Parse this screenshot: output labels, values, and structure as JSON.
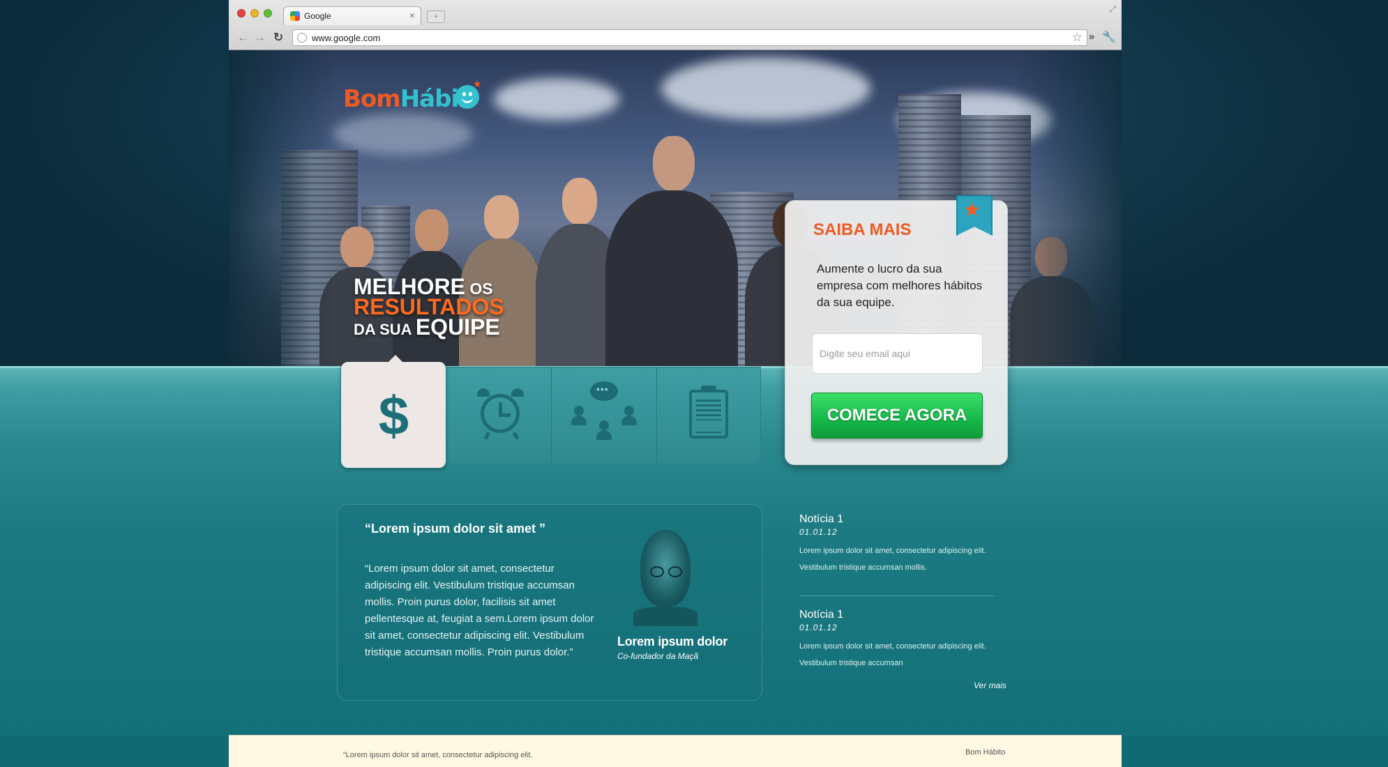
{
  "browser": {
    "tab_title": "Google",
    "tab_close": "×",
    "new_tab": "+",
    "url": "www.google.com",
    "icons": {
      "back": "arrow-left",
      "forward": "arrow-right",
      "reload": "reload",
      "bookmark": "star",
      "extensions": "chevrons",
      "settings": "wrench"
    }
  },
  "brand": {
    "name_part1": "Bom",
    "name_part2": "Hábit",
    "primary_color": "#ee5a24",
    "secondary_color": "#33c1d0"
  },
  "hero": {
    "line1_big": "MELHORE",
    "line1_small": " OS",
    "line2": "RESULTADOS",
    "line3_small": "DA SUA ",
    "line3_big": "EQUIPE"
  },
  "feature_tabs": [
    {
      "icon": "dollar-icon",
      "symbol": "$",
      "active": true
    },
    {
      "icon": "alarm-clock-icon",
      "active": false
    },
    {
      "icon": "team-chat-icon",
      "chat_dots": "•••",
      "active": false
    },
    {
      "icon": "clipboard-report-icon",
      "active": false
    }
  ],
  "signup": {
    "title": "SAIBA MAIS",
    "description": "Aumente o lucro da sua empresa com melhores hábitos da sua equipe.",
    "email_placeholder": "Digite seu email aqui",
    "email_value": "",
    "cta_label": "COMECE AGORA",
    "cta_color": "#15b848"
  },
  "testimonial": {
    "title": "“Lorem ipsum dolor sit amet ”",
    "quote": "“Lorem ipsum dolor sit amet, consectetur adipiscing elit. Vestibulum tristique accumsan mollis. Proin purus dolor, facilisis sit amet pellentesque at, feugiat a sem.Lorem ipsum dolor sit amet, consectetur adipiscing elit. Vestibulum tristique accumsan mollis. Proin purus dolor.”",
    "author_name": "Lorem ipsum dolor",
    "author_role": "Co-fundador da Maçã"
  },
  "news": [
    {
      "title": "Notícia 1",
      "date": "01.01.12",
      "body": "Lorem ipsum dolor sit amet, consectetur adipiscing elit. Vestibulum tristique accumsan mollis."
    },
    {
      "title": "Notícia 1",
      "date": "01.01.12",
      "body": "Lorem ipsum dolor sit amet, consectetur adipiscing elit. Vestibulum tristique accumsan"
    }
  ],
  "ver_mais": "Ver mais",
  "footer": {
    "left": "“Lorem ipsum dolor sit amet, consectetur adipiscing elit.",
    "right": "Bom Hábito"
  }
}
